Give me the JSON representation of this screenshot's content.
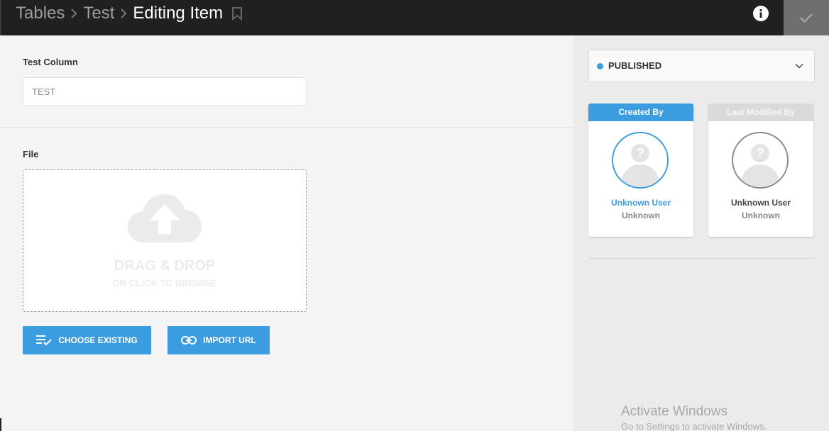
{
  "header": {
    "breadcrumbs": [
      "Tables",
      "Test",
      "Editing Item"
    ],
    "icons": {
      "bookmark": "bookmark-icon",
      "info": "info-icon",
      "save": "check-icon"
    }
  },
  "form": {
    "test_column": {
      "label": "Test Column",
      "value": "TEST"
    },
    "file": {
      "label": "File",
      "drop_title": "DRAG & DROP",
      "drop_subtitle": "OR CLICK TO BROWSE"
    },
    "buttons": {
      "choose_existing": "CHOOSE EXISTING",
      "import_url": "IMPORT URL"
    }
  },
  "sidebar": {
    "status": {
      "label": "PUBLISHED",
      "color": "#3c9ce0"
    },
    "created_by": {
      "title": "Created By",
      "name": "Unknown User",
      "role": "Unknown"
    },
    "last_modified_by": {
      "title": "Last Modified By",
      "name": "Unknown User",
      "role": "Unknown"
    }
  },
  "watermark": {
    "title": "Activate Windows",
    "subtitle": "Go to Settings to activate Windows."
  },
  "colors": {
    "accent": "#3c9ce0",
    "header_bg": "#202020"
  }
}
